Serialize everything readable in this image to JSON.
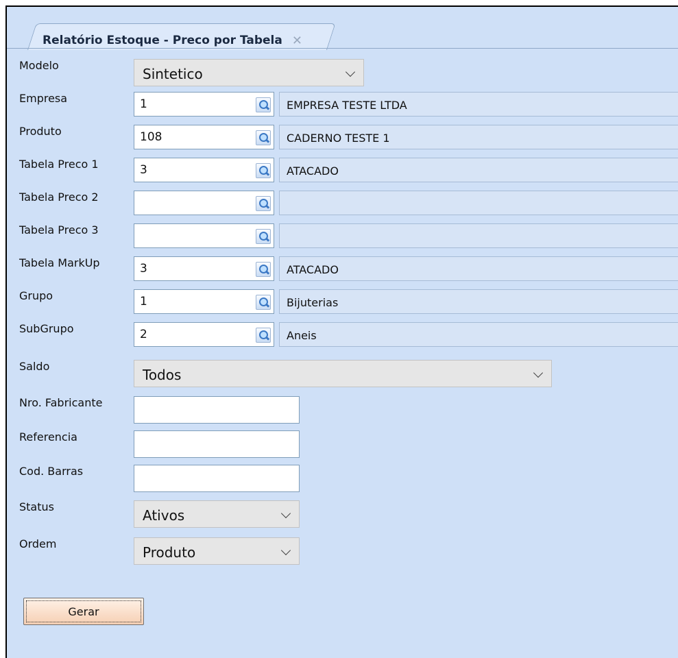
{
  "tab": {
    "title": "Relatório Estoque - Preco por Tabela",
    "close_glyph": "✕"
  },
  "modelo": {
    "label": "Modelo",
    "value": "Sintetico"
  },
  "lookups": [
    {
      "label": "Empresa",
      "code": "1",
      "desc": "EMPRESA TESTE LTDA"
    },
    {
      "label": "Produto",
      "code": "108",
      "desc": "CADERNO TESTE 1"
    },
    {
      "label": "Tabela Preco 1",
      "code": "3",
      "desc": "ATACADO"
    },
    {
      "label": "Tabela Preco 2",
      "code": "",
      "desc": ""
    },
    {
      "label": "Tabela Preco 3",
      "code": "",
      "desc": ""
    },
    {
      "label": "Tabela MarkUp",
      "code": "3",
      "desc": "ATACADO"
    },
    {
      "label": "Grupo",
      "code": "1",
      "desc": "Bijuterias"
    },
    {
      "label": "SubGrupo",
      "code": "2",
      "desc": "Aneis"
    }
  ],
  "saldo": {
    "label": "Saldo",
    "value": "Todos"
  },
  "nro_fabricante": {
    "label": "Nro. Fabricante",
    "value": ""
  },
  "referencia": {
    "label": "Referencia",
    "value": ""
  },
  "cod_barras": {
    "label": "Cod. Barras",
    "value": ""
  },
  "status": {
    "label": "Status",
    "value": "Ativos"
  },
  "ordem": {
    "label": "Ordem",
    "value": "Produto"
  },
  "gerar": {
    "label": "Gerar"
  },
  "colors": {
    "panel": "#cfe0f7",
    "accent": "#1f6fb7"
  }
}
